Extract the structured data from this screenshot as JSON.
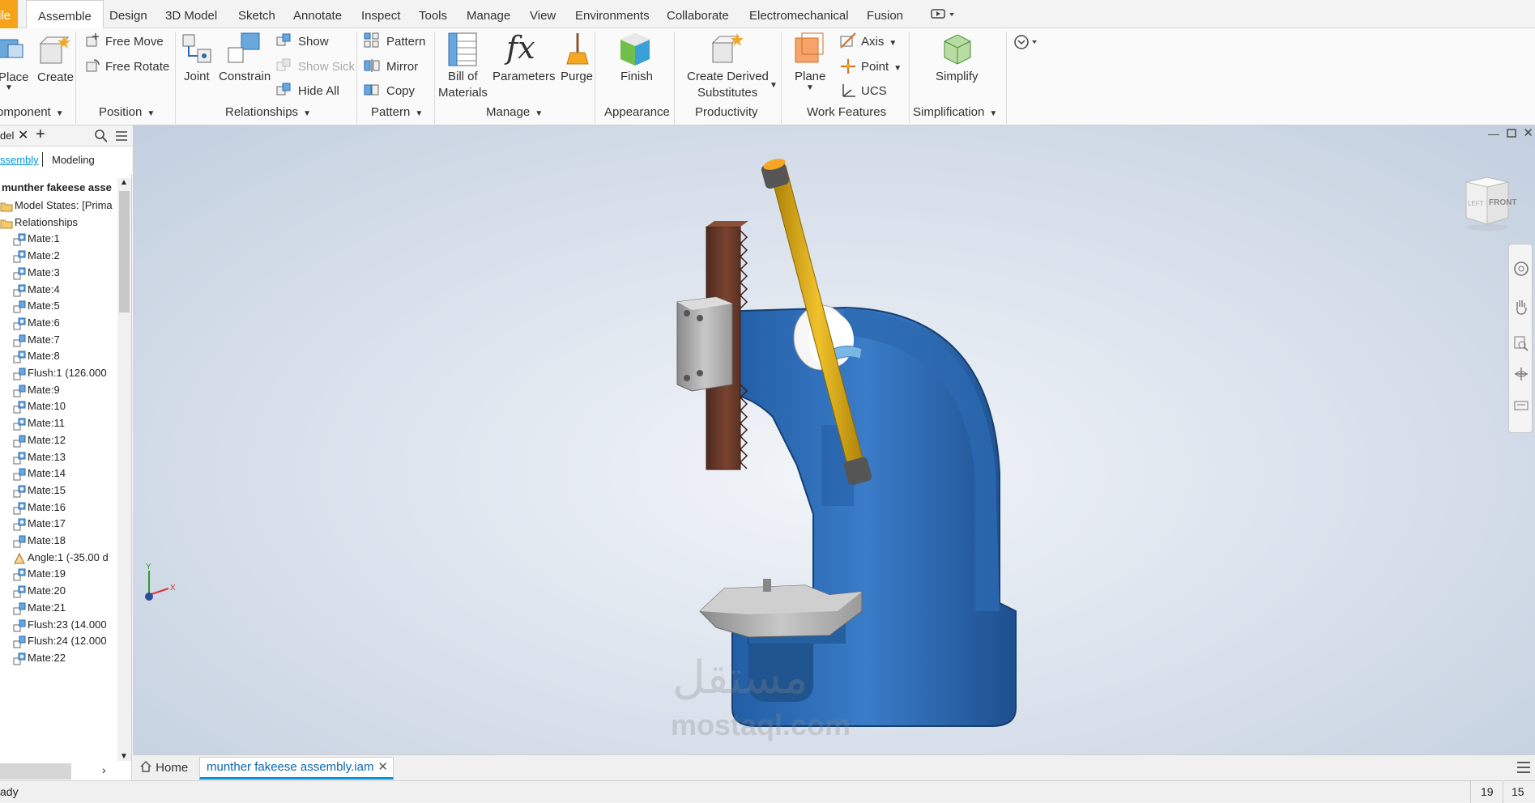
{
  "menu": {
    "file": "ile",
    "tabs": [
      "Assemble",
      "Design",
      "3D Model",
      "Sketch",
      "Annotate",
      "Inspect",
      "Tools",
      "Manage",
      "View",
      "Environments",
      "Collaborate",
      "Electromechanical",
      "Fusion"
    ]
  },
  "ribbon": {
    "component": {
      "place": "Place",
      "create": "Create",
      "label": "omponent"
    },
    "position": {
      "free_move": "Free Move",
      "free_rotate": "Free Rotate",
      "label": "Position"
    },
    "relationships": {
      "joint": "Joint",
      "constrain": "Constrain",
      "show": "Show",
      "show_sick": "Show Sick",
      "hide_all": "Hide All",
      "label": "Relationships"
    },
    "pattern": {
      "pattern": "Pattern",
      "mirror": "Mirror",
      "copy": "Copy",
      "label": "Pattern"
    },
    "manage": {
      "bom_line1": "Bill of",
      "bom_line2": "Materials",
      "parameters": "Parameters",
      "purge": "Purge",
      "label": "Manage"
    },
    "appearance": {
      "finish": "Finish",
      "label": "Appearance"
    },
    "productivity": {
      "line1": "Create Derived",
      "line2": "Substitutes",
      "label": "Productivity"
    },
    "work_features": {
      "plane": "Plane",
      "axis": "Axis",
      "point": "Point",
      "ucs": "UCS",
      "label": "Work Features"
    },
    "simplification": {
      "simplify": "Simplify",
      "label": "Simplification"
    }
  },
  "browser": {
    "tab_label": "del",
    "sub_assembly": "ssembly",
    "sub_modeling": "Modeling",
    "root": "munther fakeese asse",
    "items": [
      {
        "label": "Model States: [Prima",
        "type": "folder"
      },
      {
        "label": "Relationships",
        "type": "folder"
      },
      {
        "label": "Mate:1",
        "type": "mate"
      },
      {
        "label": "Mate:2",
        "type": "mate"
      },
      {
        "label": "Mate:3",
        "type": "mate"
      },
      {
        "label": "Mate:4",
        "type": "mate"
      },
      {
        "label": "Mate:5",
        "type": "flush"
      },
      {
        "label": "Mate:6",
        "type": "mate"
      },
      {
        "label": "Mate:7",
        "type": "flush"
      },
      {
        "label": "Mate:8",
        "type": "mate"
      },
      {
        "label": "Flush:1 (126.000",
        "type": "flush"
      },
      {
        "label": "Mate:9",
        "type": "flush"
      },
      {
        "label": "Mate:10",
        "type": "mate"
      },
      {
        "label": "Mate:11",
        "type": "mate"
      },
      {
        "label": "Mate:12",
        "type": "flush"
      },
      {
        "label": "Mate:13",
        "type": "mate"
      },
      {
        "label": "Mate:14",
        "type": "flush"
      },
      {
        "label": "Mate:15",
        "type": "mate"
      },
      {
        "label": "Mate:16",
        "type": "mate"
      },
      {
        "label": "Mate:17",
        "type": "mate"
      },
      {
        "label": "Mate:18",
        "type": "flush"
      },
      {
        "label": "Angle:1 (-35.00 d",
        "type": "angle"
      },
      {
        "label": "Mate:19",
        "type": "mate"
      },
      {
        "label": "Mate:20",
        "type": "mate"
      },
      {
        "label": "Mate:21",
        "type": "flush"
      },
      {
        "label": "Flush:23 (14.000",
        "type": "flush"
      },
      {
        "label": "Flush:24 (12.000",
        "type": "flush"
      },
      {
        "label": "Mate:22",
        "type": "mate"
      }
    ]
  },
  "viewcube": {
    "front": "FRONT",
    "left": "LEFT"
  },
  "doc_tabs": {
    "home": "Home",
    "active": "munther fakeese assembly.iam"
  },
  "status": {
    "left": "ady",
    "n1": "19",
    "n2": "15"
  },
  "watermark": {
    "arabic": "مستقل",
    "latin": "mostaql.com"
  },
  "colors": {
    "accent": "#0696d7",
    "file_tab": "#f5a31a",
    "press_blue": "#2f6fb8",
    "handle_yellow": "#d4a514",
    "rack_brown": "#6b3a2a"
  }
}
